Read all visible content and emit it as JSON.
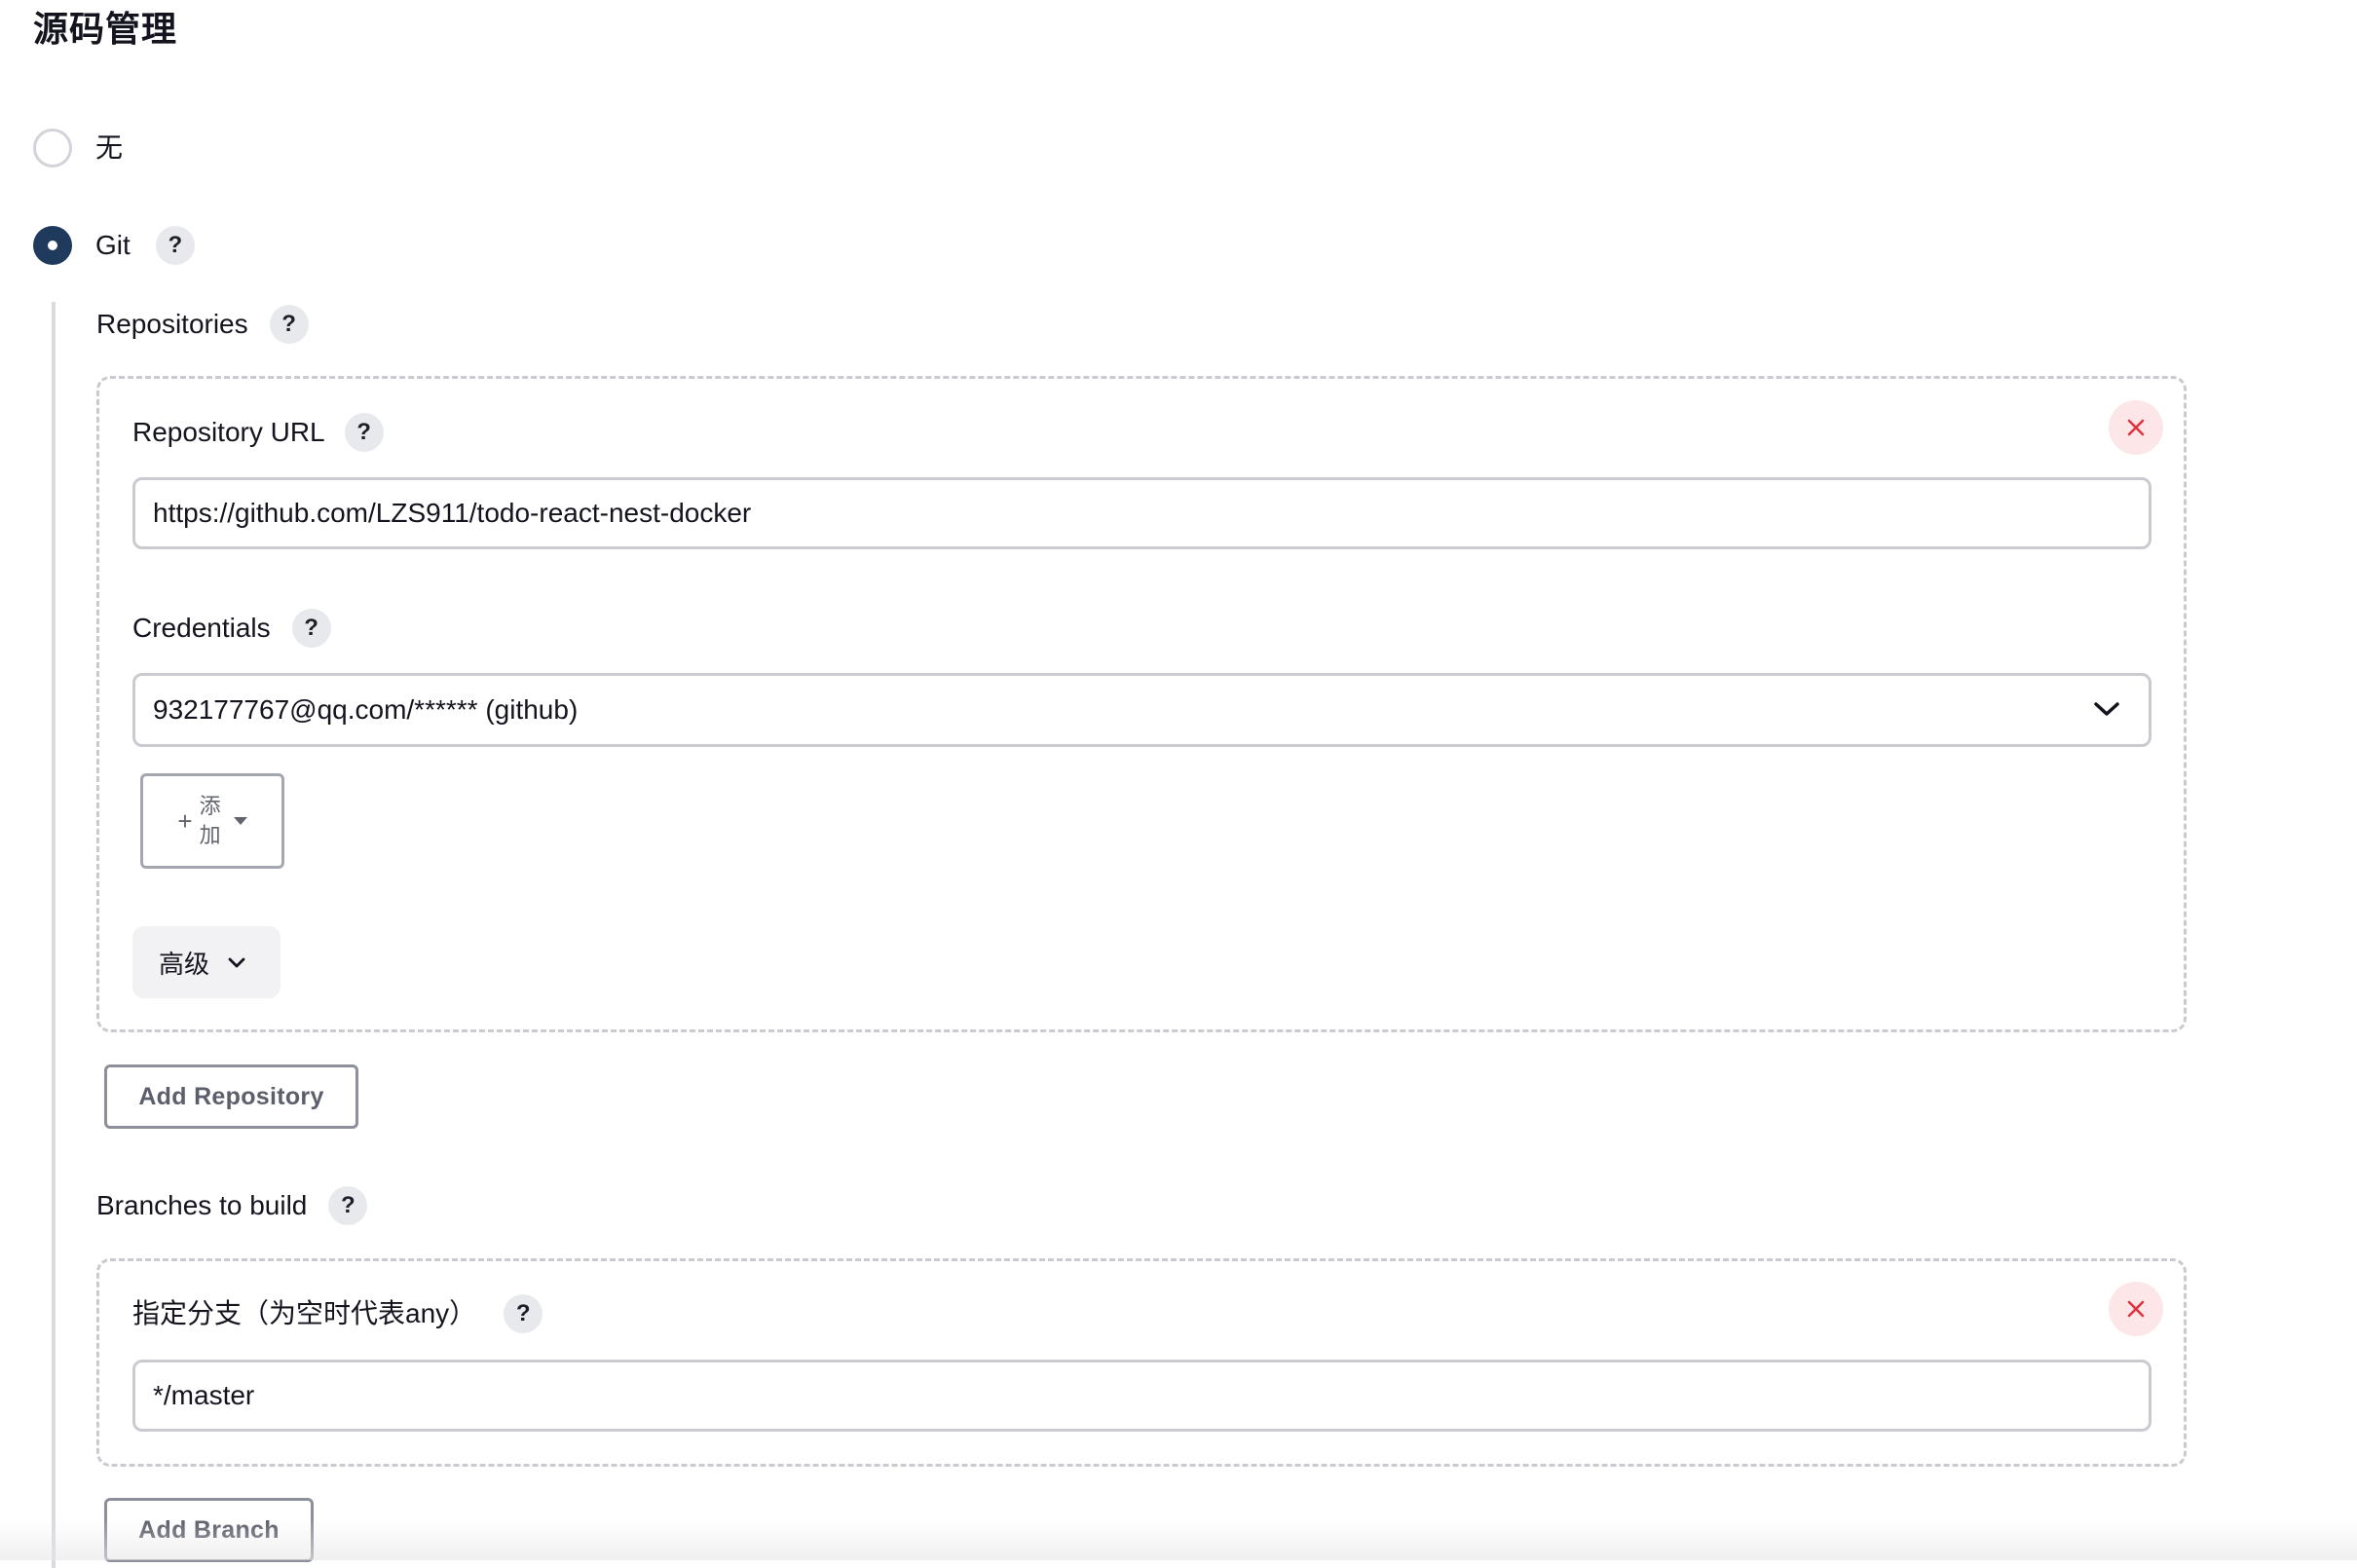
{
  "section": {
    "title": "源码管理"
  },
  "scm_options": [
    {
      "label": "无",
      "checked": false
    },
    {
      "label": "Git",
      "checked": true
    }
  ],
  "repositories": {
    "label": "Repositories",
    "repository_url_label": "Repository URL",
    "repository_url_value": "https://github.com/LZS911/todo-react-nest-docker",
    "credentials_label": "Credentials",
    "credentials_selected": "932177767@qq.com/****** (github)",
    "add_button": {
      "icon": "plus-icon",
      "line1": "添",
      "line2": "加"
    },
    "advanced_label": "高级",
    "add_repository_label": "Add Repository"
  },
  "branches": {
    "label": "Branches to build",
    "branch_specifier_label": "指定分支（为空时代表any）",
    "branch_specifier_value": "*/master",
    "add_branch_label": "Add Branch"
  },
  "help_glyph": "?",
  "colors": {
    "radio_checked": "#1f3a5c",
    "close_icon": "#e0313d",
    "close_bg": "#fde6e8",
    "border": "#c9cbd1"
  }
}
